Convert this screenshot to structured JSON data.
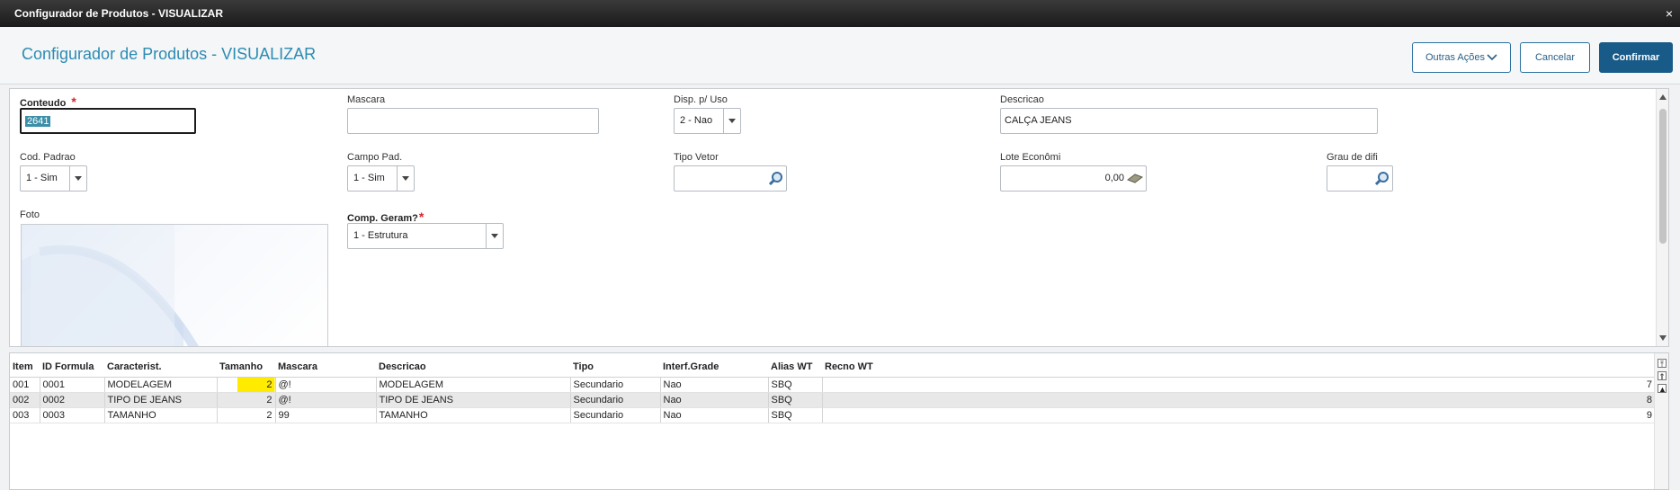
{
  "window": {
    "title": "Configurador de Produtos - VISUALIZAR",
    "close": "×"
  },
  "header": {
    "title": "Configurador de Produtos - VISUALIZAR",
    "outras_acoes": "Outras Ações",
    "cancelar": "Cancelar",
    "confirmar": "Confirmar"
  },
  "form": {
    "conteudo": {
      "label": "Conteudo",
      "required": "*",
      "value": "2641"
    },
    "mascara": {
      "label": "Mascara",
      "value": ""
    },
    "disp_uso": {
      "label": "Disp. p/ Uso",
      "value": "2 - Nao"
    },
    "descricao": {
      "label": "Descricao",
      "value": "CALÇA JEANS"
    },
    "cod_padrao": {
      "label": "Cod. Padrao",
      "value": "1 - Sim"
    },
    "campo_pad": {
      "label": "Campo Pad.",
      "value": "1 - Sim"
    },
    "tipo_vetor": {
      "label": "Tipo Vetor",
      "value": ""
    },
    "lote_economi": {
      "label": "Lote Econômi",
      "value": "0,00"
    },
    "grau_difi": {
      "label": "Grau de difi",
      "value": ""
    },
    "foto": {
      "label": "Foto"
    },
    "comp_geram": {
      "label": "Comp. Geram?",
      "required": "*",
      "value": "1 - Estrutura"
    }
  },
  "grid": {
    "headers": [
      "Item",
      "ID Formula",
      "Caracterist.",
      "Tamanho",
      "Mascara",
      "Descricao",
      "Tipo",
      "Interf.Grade",
      "Alias WT",
      "Recno WT"
    ],
    "rows": [
      [
        "001",
        "0001",
        "MODELAGEM",
        "2",
        "@!",
        "MODELAGEM",
        "Secundario",
        "Nao",
        "SBQ",
        "7"
      ],
      [
        "002",
        "0002",
        "TIPO DE JEANS",
        "2",
        "@!",
        "TIPO DE JEANS",
        "Secundario",
        "Nao",
        "SBQ",
        "8"
      ],
      [
        "003",
        "0003",
        "TAMANHO",
        "2",
        "99",
        "TAMANHO",
        "Secundario",
        "Nao",
        "SBQ",
        "9"
      ]
    ]
  },
  "colors": {
    "accent": "#2d8bb3",
    "primary_button": "#185a88",
    "required": "#d9232d",
    "highlight": "#ffeb00"
  }
}
